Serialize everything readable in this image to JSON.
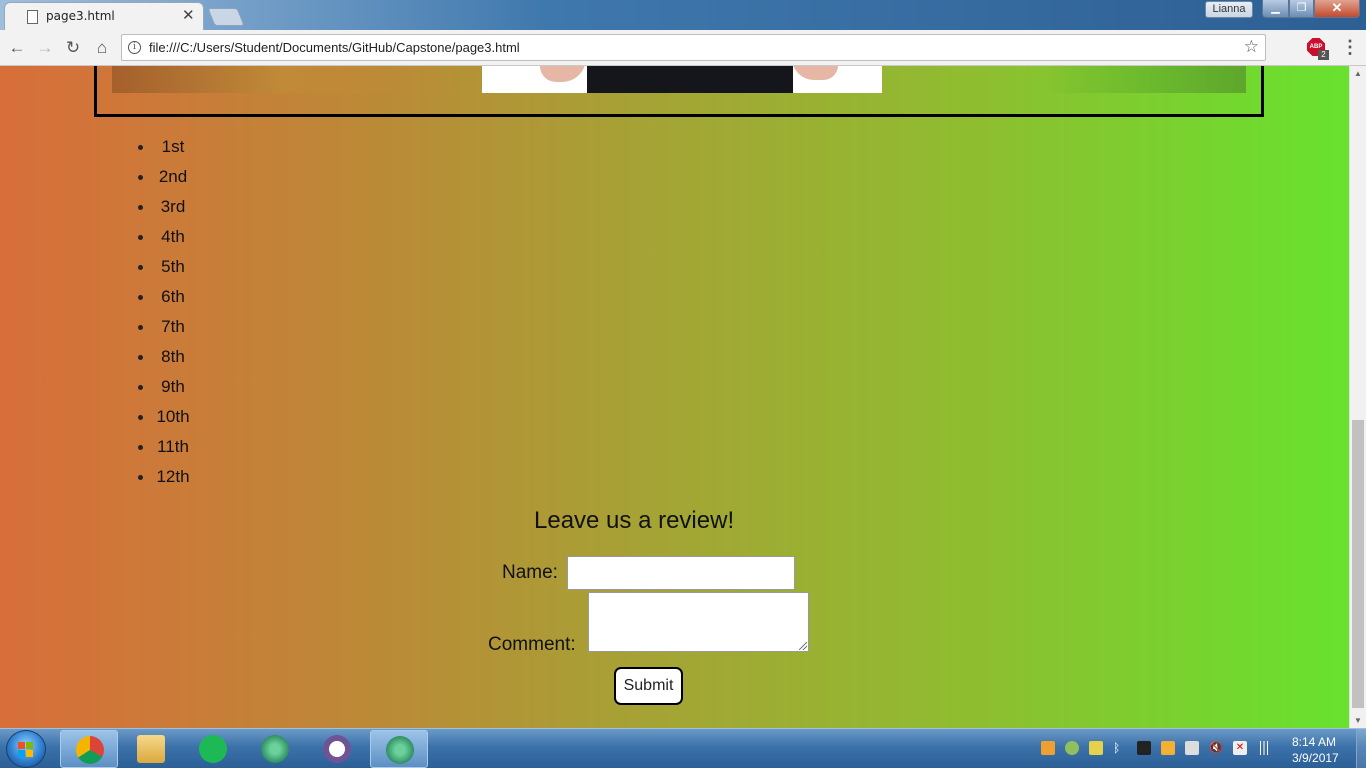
{
  "browser": {
    "tab_title": "page3.html",
    "profile_name": "Lianna",
    "url": "file:///C:/Users/Student/Documents/GitHub/Capstone/page3.html",
    "adblock_badge": "2",
    "adblock_label": "ABP"
  },
  "page": {
    "grades": [
      "1st",
      "2nd",
      "3rd",
      "4th",
      "5th",
      "6th",
      "7th",
      "8th",
      "9th",
      "10th",
      "11th",
      "12th"
    ],
    "review": {
      "heading": "Leave us a review!",
      "name_label": "Name:",
      "name_value": "",
      "comment_label": "Comment:",
      "comment_value": "",
      "submit_label": "Submit"
    }
  },
  "taskbar": {
    "apps": [
      "chrome",
      "file-explorer",
      "spotify",
      "atom",
      "github-desktop",
      "atom"
    ],
    "time": "8:14 AM",
    "date": "3/9/2017"
  },
  "colors": {
    "page_gradient_left": "#d86e3a",
    "page_gradient_right": "#68e22e"
  }
}
